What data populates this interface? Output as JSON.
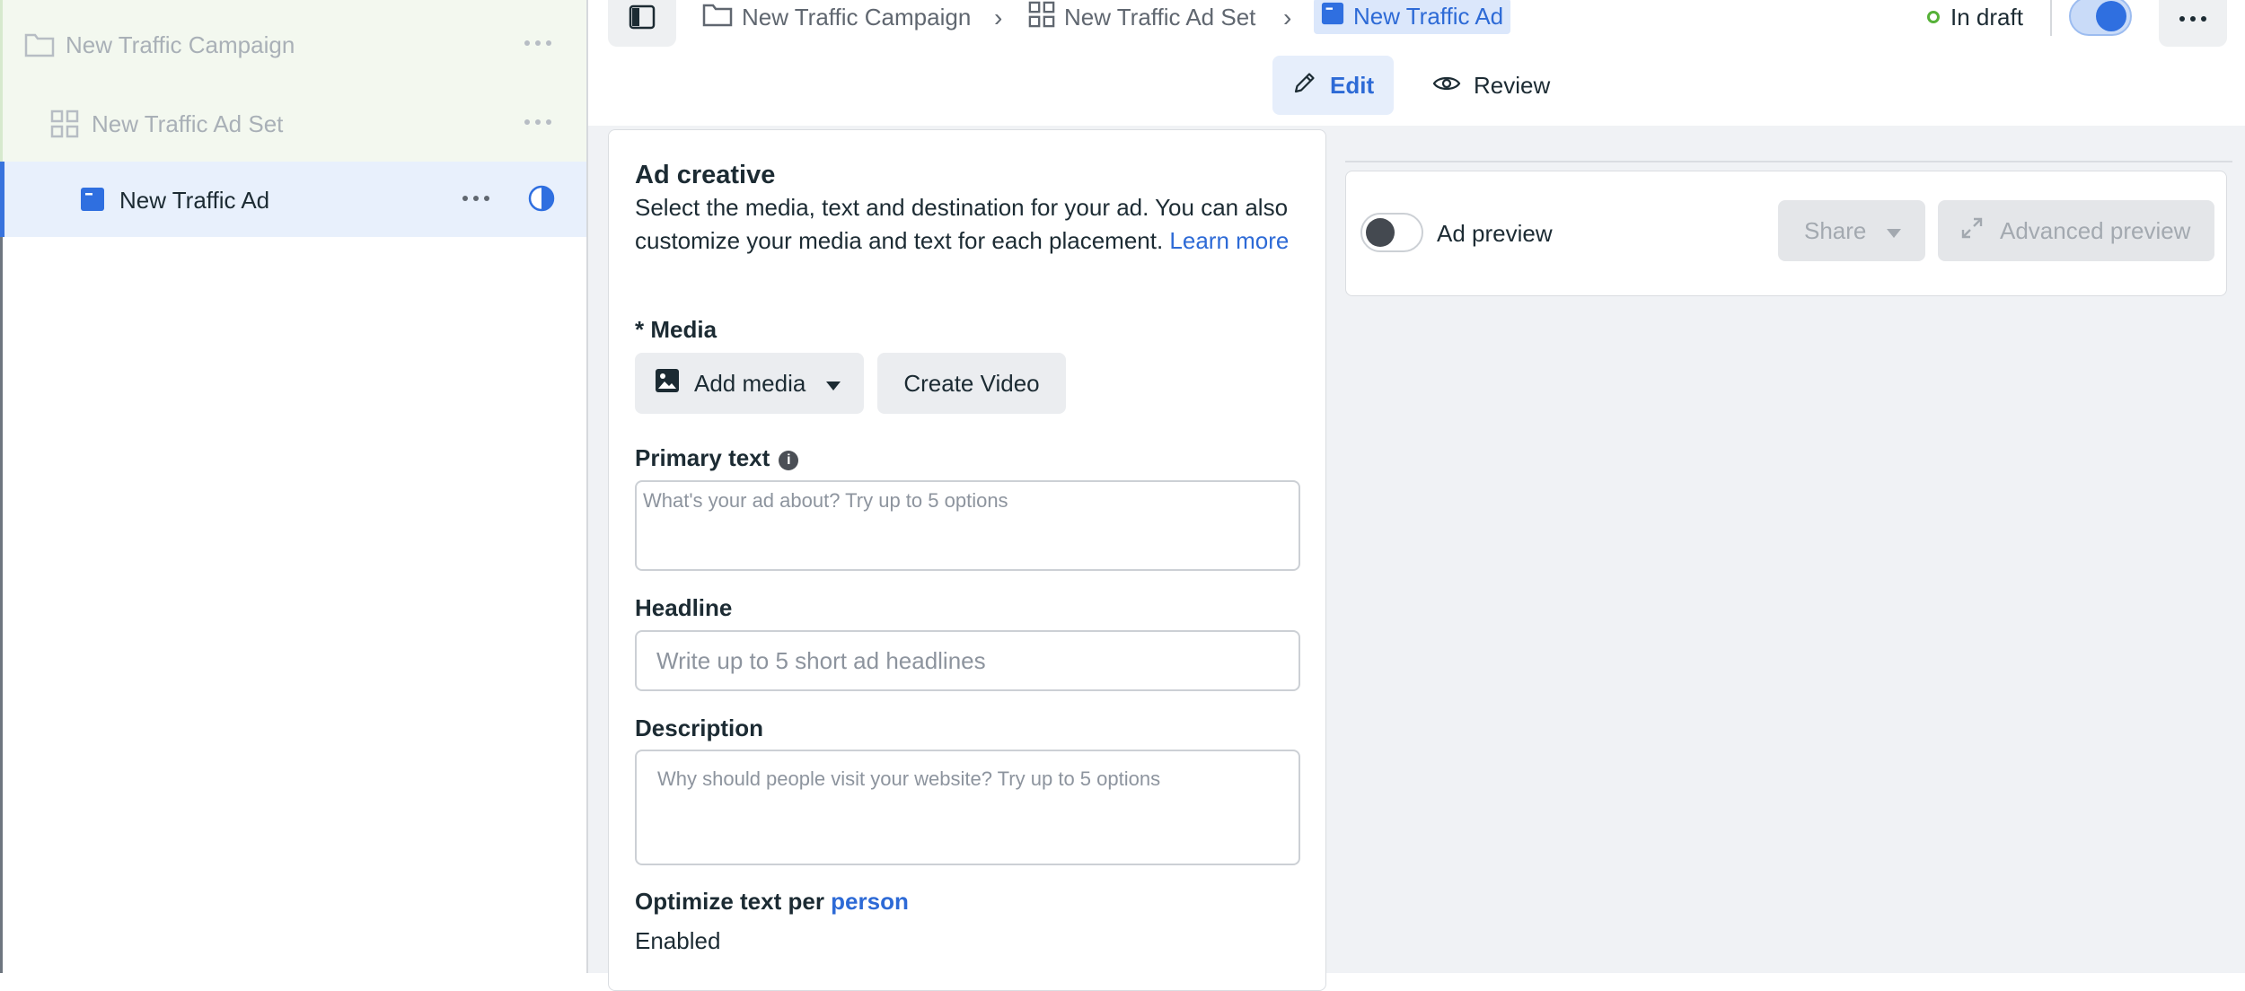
{
  "tree": {
    "campaign": {
      "label": "New Traffic Campaign",
      "icon": "folder-icon"
    },
    "adset": {
      "label": "New Traffic Ad Set",
      "icon": "grid-icon"
    },
    "ad": {
      "label": "New Traffic Ad",
      "icon": "ad-icon"
    }
  },
  "breadcrumb": {
    "campaign": "New Traffic Campaign",
    "adset": "New Traffic Ad Set",
    "ad": "New Traffic Ad"
  },
  "status": {
    "label": "In draft",
    "color": "#56b138"
  },
  "tabs": {
    "edit": "Edit",
    "review": "Review"
  },
  "ad_creative": {
    "title": "Ad creative",
    "description": "Select the media, text and destination for your ad. You can also customize your media and text for each placement.",
    "learn_more": "Learn more",
    "media": {
      "label": "* Media",
      "add_media": "Add media",
      "create_video": "Create Video"
    },
    "primary_text": {
      "label": "Primary text",
      "placeholder": "What's your ad about? Try up to 5 options",
      "value": ""
    },
    "headline": {
      "label": "Headline",
      "placeholder": "Write up to 5 short ad headlines",
      "value": ""
    },
    "description_field": {
      "label": "Description",
      "placeholder": "Why should people visit your website? Try up to 5 options",
      "value": ""
    },
    "optimize": {
      "label": "Optimize text per",
      "link": "person",
      "value": "Enabled"
    }
  },
  "preview": {
    "label": "Ad preview",
    "share": "Share",
    "advanced": "Advanced preview"
  },
  "colors": {
    "accent": "#2d6ad6",
    "selected_row": "#e8f0fc",
    "parent_rows": "#f3f8ef"
  }
}
